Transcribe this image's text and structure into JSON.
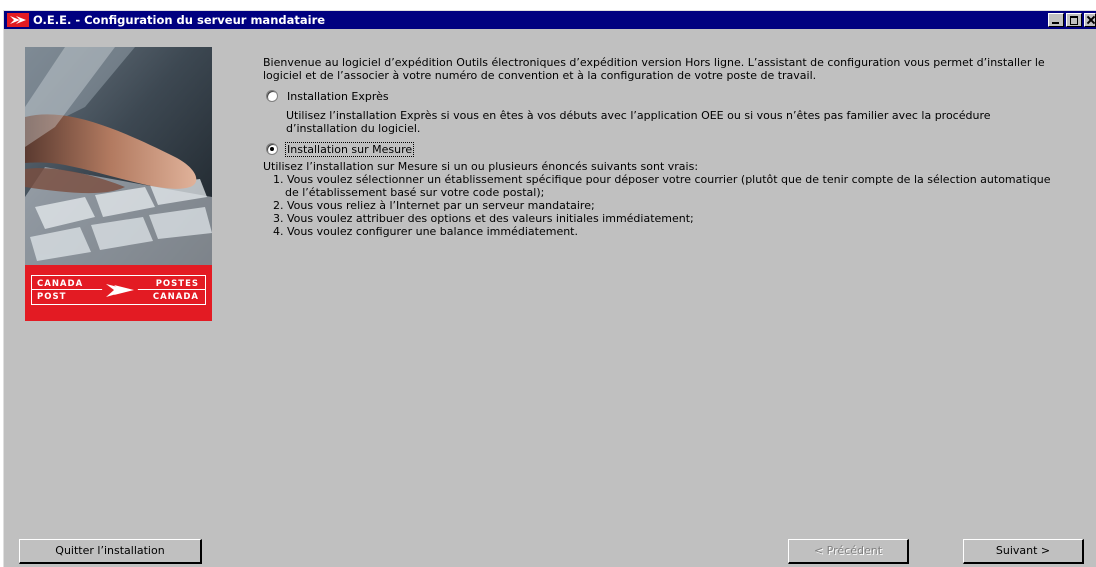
{
  "window": {
    "title": "O.E.E. - Configuration du serveur mandataire",
    "title_bar_color": "#000080",
    "buttons": [
      "minimize",
      "maximize",
      "close"
    ]
  },
  "side_panel": {
    "logo": {
      "left_top": "CANADA",
      "left_bottom": "POST",
      "right_top": "POSTES",
      "right_bottom": "CANADA",
      "color": "#e31b23"
    }
  },
  "content": {
    "intro": "Bienvenue au logiciel d’expédition Outils électroniques d’expédition version Hors ligne. L’assistant de configuration vous permet d’installer le logiciel et de l’associer à votre numéro de convention et à la configuration de votre poste de travail.",
    "options": [
      {
        "label": "Installation Exprès",
        "checked": false,
        "description": "Utilisez l’installation Exprès si vous en êtes à vos débuts avec l’application OEE ou si vous n’êtes pas familier avec la procédure d’installation du logiciel."
      },
      {
        "label": "Installation sur Mesure",
        "checked": true,
        "description": "Utilisez l’installation sur Mesure si un ou plusieurs énoncés suivants sont vrais:",
        "items": [
          "1. Vous voulez sélectionner un établissement spécifique  pour déposer votre courrier (plutôt que de tenir compte de la sélection automatique de l’établissement basé sur votre code postal);",
          "2. Vous vous reliez à l’Internet par un serveur mandataire;",
          "3. Vous voulez attribuer des options et des valeurs initiales immédiatement;",
          "4. Vous voulez configurer une balance immédiatement."
        ]
      }
    ]
  },
  "footer": {
    "quit_label": "Quitter l’installation",
    "prev_label": "< Précédent",
    "next_label": "Suivant >"
  }
}
